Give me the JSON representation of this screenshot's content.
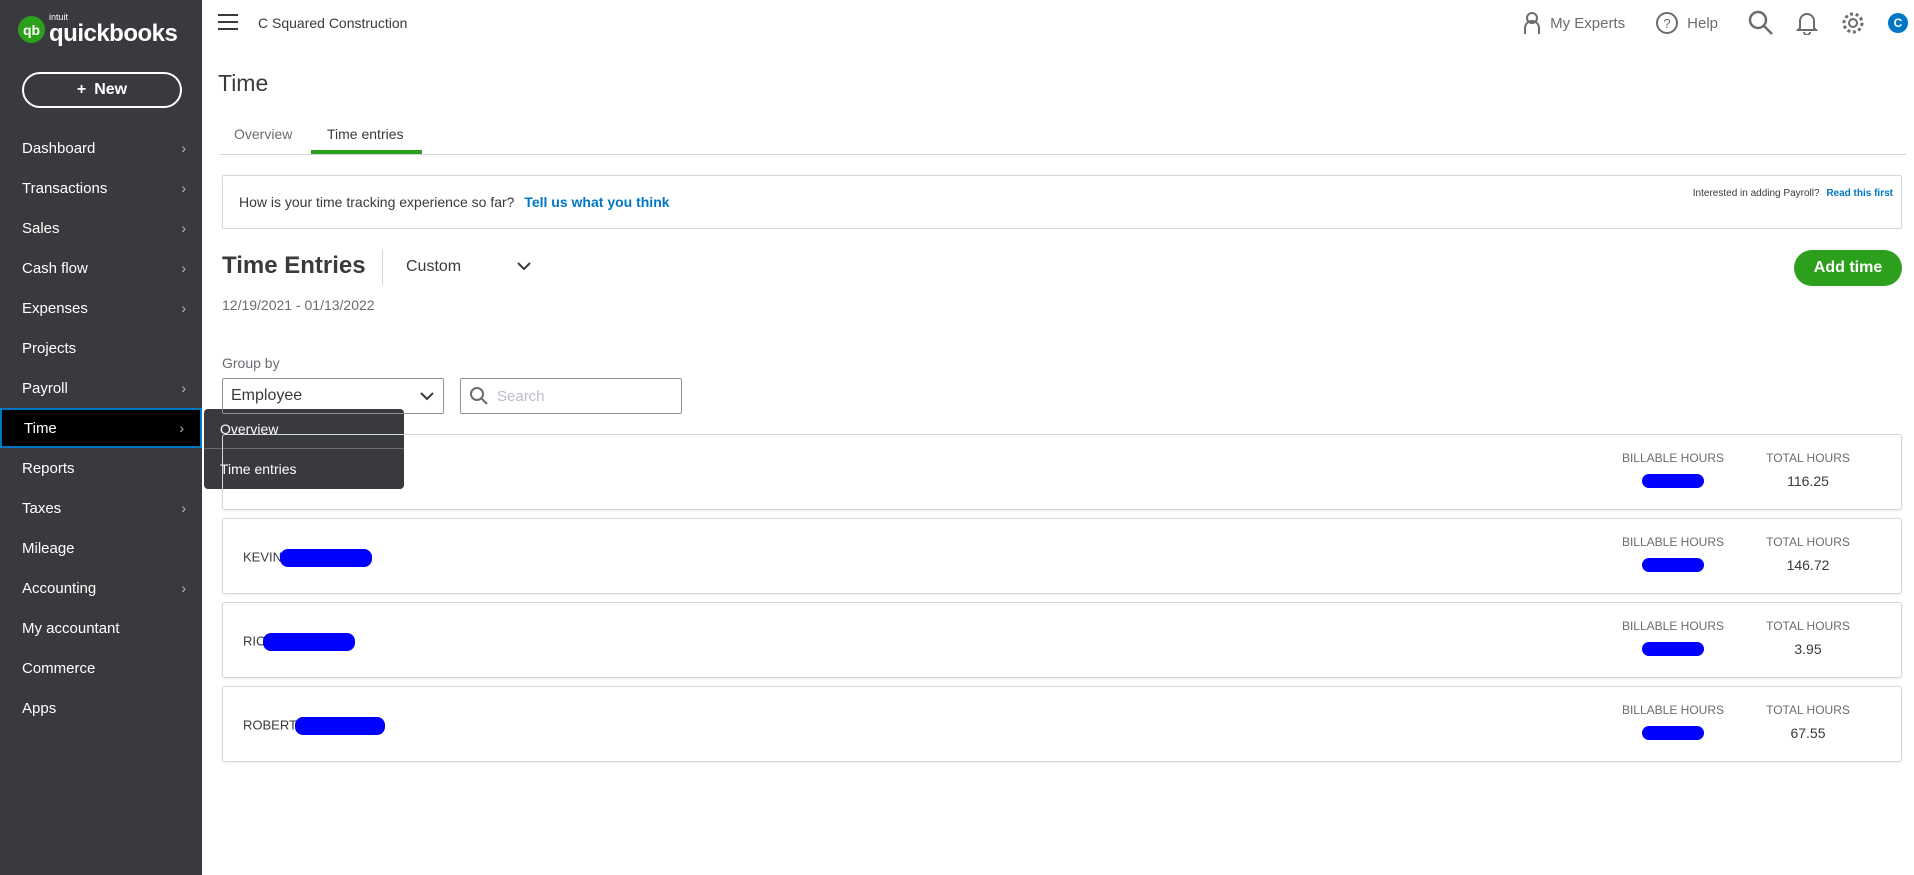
{
  "brand": {
    "intuit": "intuit",
    "name": "quickbooks",
    "mark": "qb",
    "color": "#2ca01c"
  },
  "sidebar": {
    "new_label": "New",
    "items": [
      {
        "label": "Dashboard",
        "chevron": true
      },
      {
        "label": "Transactions",
        "chevron": true
      },
      {
        "label": "Sales",
        "chevron": true
      },
      {
        "label": "Cash flow",
        "chevron": true
      },
      {
        "label": "Expenses",
        "chevron": true
      },
      {
        "label": "Projects",
        "chevron": false
      },
      {
        "label": "Payroll",
        "chevron": true
      },
      {
        "label": "Time",
        "chevron": true,
        "active": true
      },
      {
        "label": "Reports",
        "chevron": false
      },
      {
        "label": "Taxes",
        "chevron": true
      },
      {
        "label": "Mileage",
        "chevron": false
      },
      {
        "label": "Accounting",
        "chevron": true
      },
      {
        "label": "My accountant",
        "chevron": false
      },
      {
        "label": "Commerce",
        "chevron": false
      },
      {
        "label": "Apps",
        "chevron": false
      }
    ],
    "flyout": [
      "Overview",
      "Time entries"
    ]
  },
  "topbar": {
    "company": "C Squared Construction",
    "my_experts": "My Experts",
    "help": "Help",
    "avatar_initial": "C"
  },
  "page": {
    "title": "Time",
    "tabs": [
      "Overview",
      "Time entries"
    ],
    "active_tab": "Time entries"
  },
  "banner": {
    "question": "How is your time tracking experience so far?",
    "link": "Tell us what you think",
    "right_text": "Interested in adding Payroll?",
    "right_link": "Read this first"
  },
  "time_entries": {
    "title": "Time Entries",
    "period": "Custom",
    "date_range": "12/19/2021 - 01/13/2022",
    "add_time": "Add time",
    "group_by_label": "Group by",
    "group_by_value": "Employee",
    "search_placeholder": "Search",
    "billable_label": "BILLABLE HOURS",
    "total_label": "TOTAL HOURS",
    "rows": [
      {
        "name": "",
        "total": "116.25"
      },
      {
        "name": "KEVIN",
        "total": "146.72"
      },
      {
        "name": "RIC",
        "total": "3.95"
      },
      {
        "name": "ROBERT",
        "total": "67.55"
      }
    ]
  }
}
